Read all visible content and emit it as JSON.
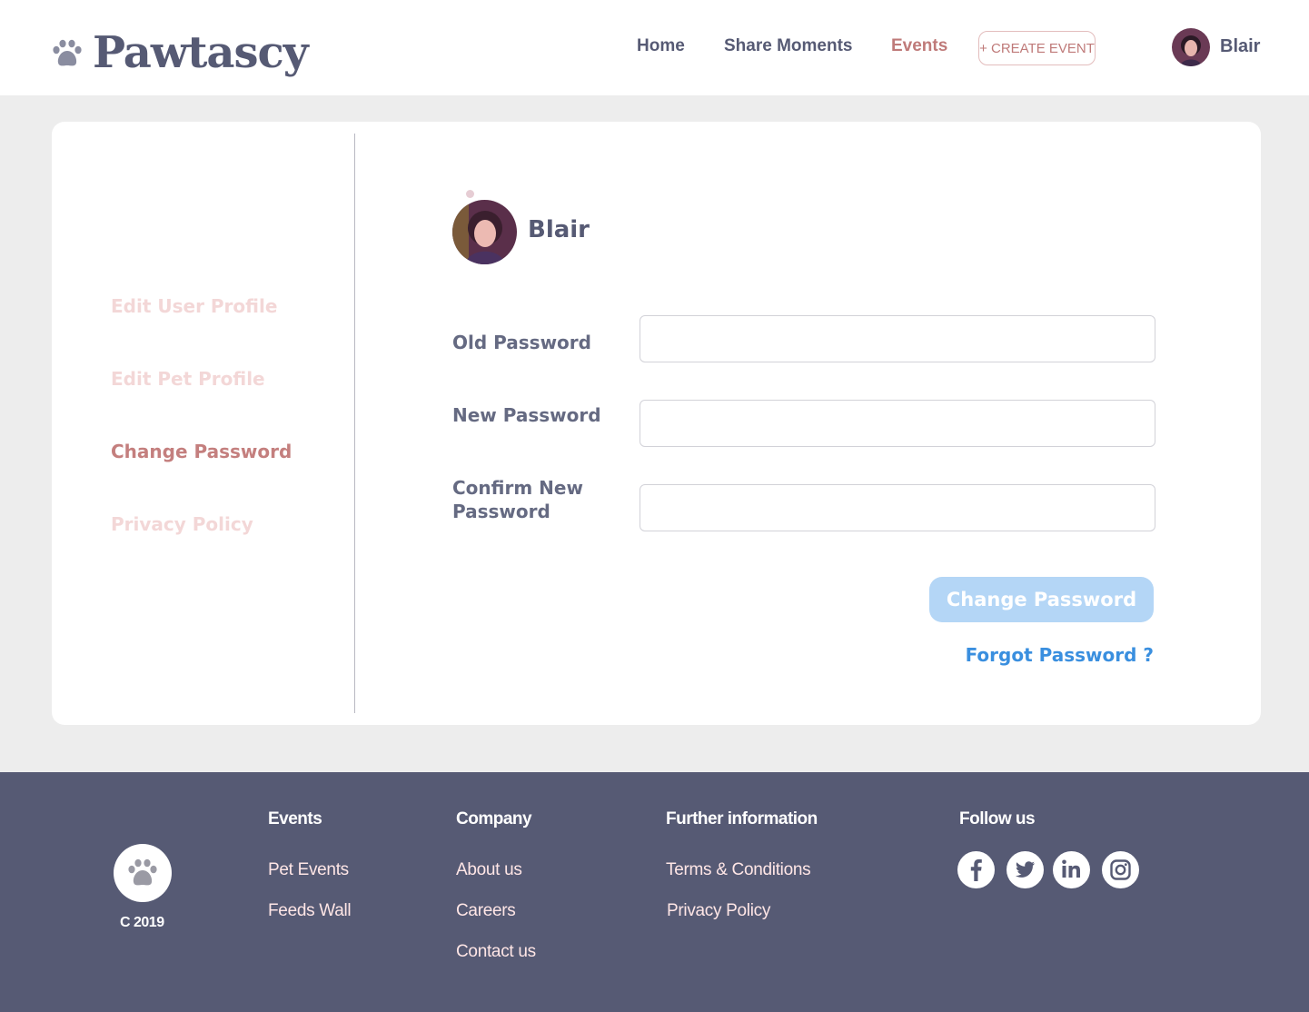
{
  "brand": {
    "name": "Pawtascy"
  },
  "nav": {
    "home": "Home",
    "share_moments": "Share Moments",
    "events": "Events",
    "create_event": "+ CREATE EVENT",
    "user_name": "Blair"
  },
  "sidebar": {
    "items": [
      {
        "label": "Edit User Profile"
      },
      {
        "label": "Edit Pet Profile"
      },
      {
        "label": "Change Password"
      },
      {
        "label": "Privacy Policy"
      }
    ]
  },
  "profile": {
    "name": "Blair"
  },
  "form": {
    "old_password": {
      "label": "Old Password",
      "value": ""
    },
    "new_password": {
      "label": "New Password",
      "value": ""
    },
    "confirm_password": {
      "label": "Confirm New Password",
      "value": ""
    },
    "submit_label": "Change Password",
    "forgot_label": "Forgot Password ?"
  },
  "footer": {
    "copyright": "C 2019",
    "columns": [
      {
        "heading": "Events",
        "links": [
          "Pet Events",
          "Feeds Wall"
        ]
      },
      {
        "heading": "Company",
        "links": [
          "About us",
          "Careers",
          "Contact us"
        ]
      },
      {
        "heading": "Further information",
        "links": [
          "Terms & Conditions",
          "Privacy Policy"
        ]
      },
      {
        "heading": "Follow us",
        "links": []
      }
    ],
    "social": [
      "facebook-icon",
      "twitter-icon",
      "linkedin-icon",
      "instagram-icon"
    ]
  },
  "colors": {
    "brand_navy": "#565a74",
    "accent_rose": "#bf7a79",
    "link_blue": "#3a8fdf",
    "button_disabled": "#b4d6f6"
  }
}
